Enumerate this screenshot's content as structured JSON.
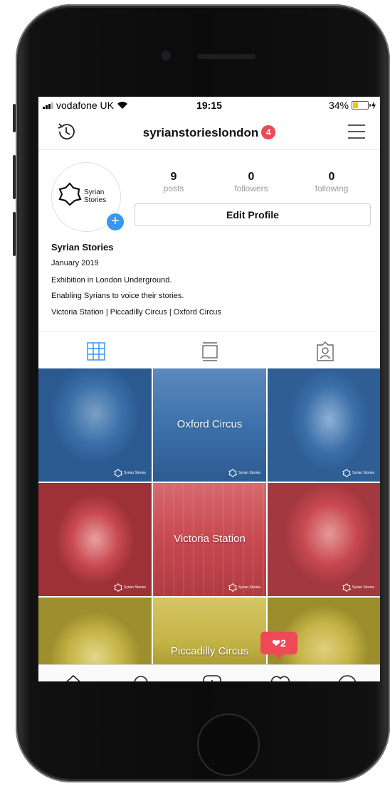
{
  "status_bar": {
    "carrier": "vodafone UK",
    "time": "19:15",
    "battery": "34%",
    "battery_level": 0.34
  },
  "header": {
    "username": "syrianstorieslondon",
    "notifications": "4"
  },
  "profile": {
    "logo_text": "Syrian Stories",
    "stats": [
      {
        "value": "9",
        "label": "posts"
      },
      {
        "value": "0",
        "label": "followers"
      },
      {
        "value": "0",
        "label": "following"
      }
    ],
    "edit_label": "Edit Profile",
    "name": "Syrian Stories",
    "bio": [
      "January 2019",
      "Exhibition in London Underground.",
      "Enabling Syrians to voice their stories.",
      "Victoria Station | Piccadilly Circus | Oxford Circus"
    ]
  },
  "grid": {
    "captions": [
      "Oxford Circus",
      "Victoria Station",
      "Piccadilly Circus"
    ],
    "watermark": "Syrian Stories",
    "row_colors": [
      "#3b6fa8",
      "#c8484f",
      "#c4b345"
    ]
  },
  "notification_bubble": {
    "count": "2"
  },
  "colors": {
    "accent": "#3897f0",
    "badge": "#ed4956"
  }
}
